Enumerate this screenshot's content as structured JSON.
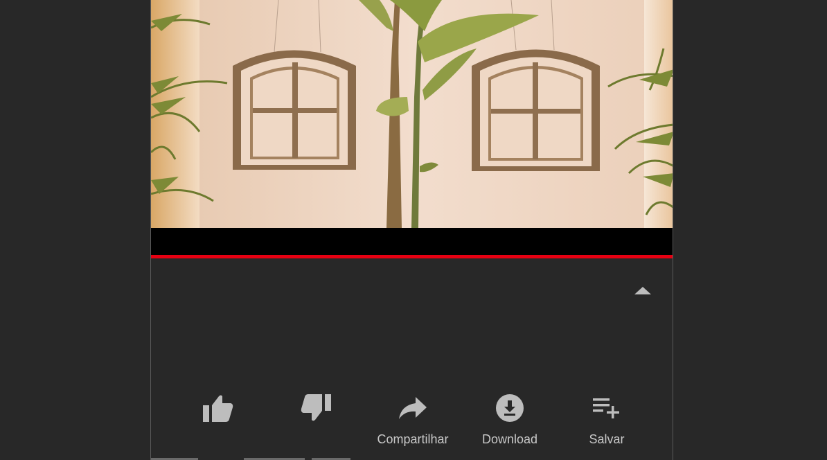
{
  "video": {
    "progress_fraction": 1.0,
    "progress_color": "#e60012"
  },
  "controls": {
    "collapse_icon": "chevron-up-icon"
  },
  "actions": [
    {
      "id": "like",
      "icon": "thumbs-up-icon",
      "label": ""
    },
    {
      "id": "dislike",
      "icon": "thumbs-down-icon",
      "label": ""
    },
    {
      "id": "share",
      "icon": "share-icon",
      "label": "Compartilhar"
    },
    {
      "id": "download",
      "icon": "download-icon",
      "label": "Download"
    },
    {
      "id": "save",
      "icon": "playlist-add-icon",
      "label": "Salvar"
    }
  ],
  "colors": {
    "background": "#282828",
    "icon": "#bdbdbd",
    "label": "#c8c8c8"
  }
}
